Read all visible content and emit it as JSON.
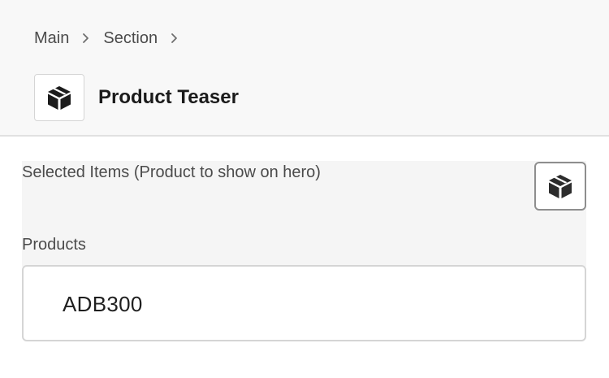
{
  "breadcrumb": {
    "items": [
      "Main",
      "Section"
    ]
  },
  "header": {
    "title": "Product Teaser",
    "icon": "product-box-icon"
  },
  "selected_items": {
    "label": "Selected Items (Product to show on hero)",
    "picker_icon": "product-box-icon"
  },
  "products": {
    "label": "Products",
    "value": "ADB300"
  },
  "colors": {
    "header_bg": "#f8f8f8",
    "panel_bg": "#f5f5f5",
    "border": "#d5d5d5",
    "button_border": "#8e8e8e",
    "text": "#2c2c2c"
  }
}
